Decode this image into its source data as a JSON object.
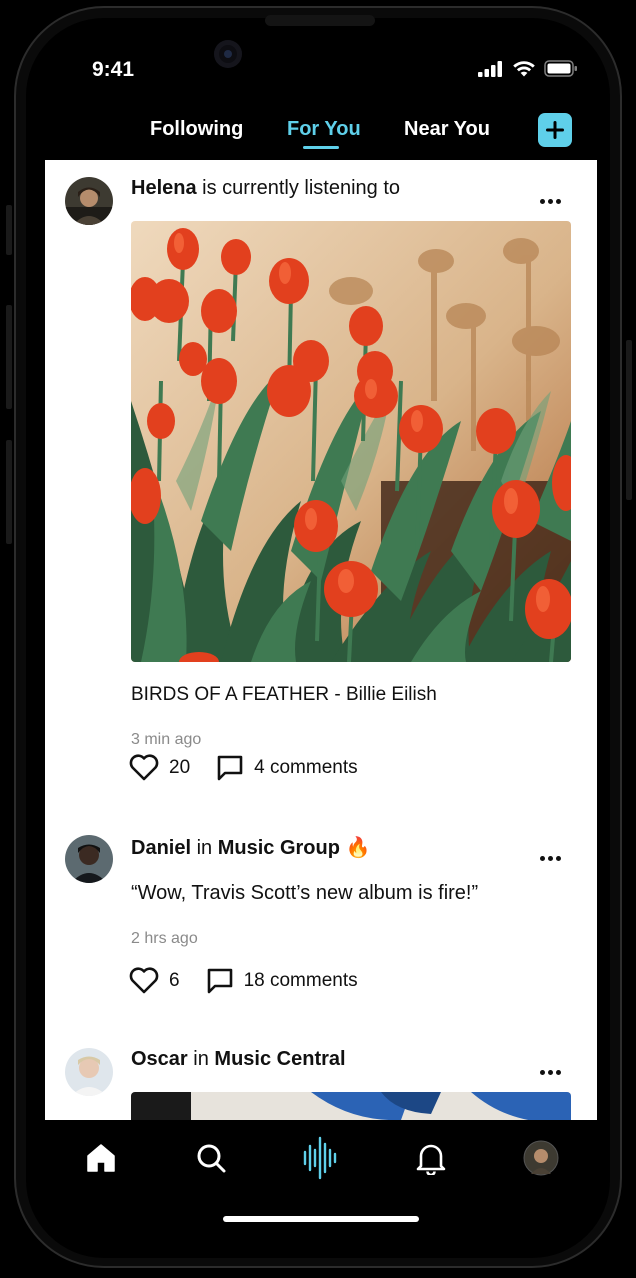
{
  "status": {
    "time": "9:41"
  },
  "top_nav": {
    "tabs": [
      {
        "label": "Following"
      },
      {
        "label": "For You",
        "active": true
      },
      {
        "label": "Near You"
      }
    ],
    "add_icon": "plus-icon"
  },
  "feed": {
    "posts": [
      {
        "user": "Helena",
        "action": "is currently listening to",
        "song": "BIRDS OF A FEATHER - Billie Eilish",
        "time": "3 min ago",
        "likes": "20",
        "comments": "4 comments",
        "image": "red tulips photo"
      },
      {
        "user": "Daniel",
        "connector": "in",
        "group": "Music Group",
        "emoji": "🔥",
        "quote": "“Wow, Travis Scott’s new album is fire!”",
        "time": "2 hrs ago",
        "likes": "6",
        "comments": "18 comments"
      },
      {
        "user": "Oscar",
        "connector": "in",
        "group": "Music Central"
      }
    ]
  },
  "bottom_nav": {
    "items": [
      "home-icon",
      "search-icon",
      "soundwave-icon",
      "bell-icon",
      "profile-avatar"
    ]
  },
  "colors": {
    "accent": "#5fd0ea",
    "background": "#000000",
    "card": "#ffffff"
  }
}
